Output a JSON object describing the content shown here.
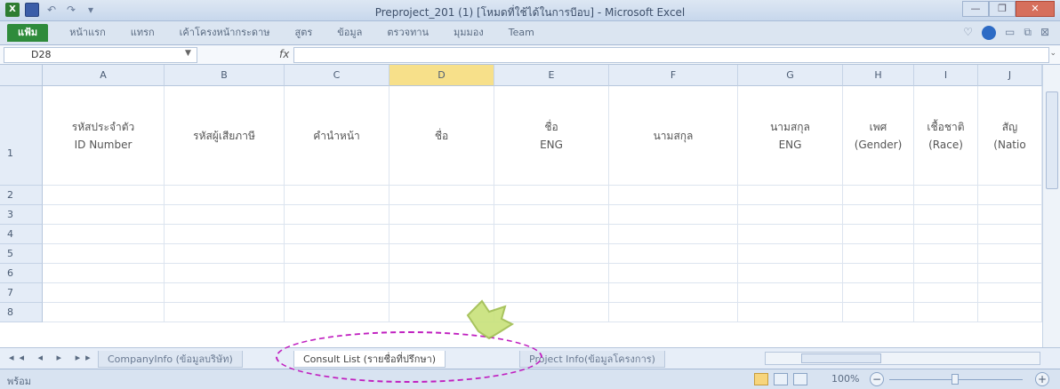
{
  "window": {
    "title": "Preproject_201 (1) [โหมดที่ใช้ได้ในการบีอบ] - Microsoft Excel",
    "qat_icons": [
      "excel-app-icon",
      "save-icon",
      "undo-icon",
      "redo-icon",
      "customize-qat-icon"
    ]
  },
  "ribbon": {
    "tabs": [
      "แฟ้ม",
      "หน้าแรก",
      "แทรก",
      "เค้าโครงหน้ากระดาษ",
      "สูตร",
      "ข้อมูล",
      "ตรวจทาน",
      "มุมมอง",
      "Team"
    ]
  },
  "formula_bar": {
    "cell_ref": "D28",
    "fx_label": "fx",
    "content": ""
  },
  "grid": {
    "columns": [
      "A",
      "B",
      "C",
      "D",
      "E",
      "F",
      "G",
      "H",
      "I",
      "J"
    ],
    "selected_column": "D",
    "rows": [
      "1",
      "2",
      "3",
      "4",
      "5",
      "6",
      "7",
      "8"
    ],
    "header_row": [
      {
        "line1": "รหัสประจำตัว",
        "line2": "ID Number"
      },
      {
        "line1": "รหัสผู้เสียภาษี",
        "line2": ""
      },
      {
        "line1": "คำนำหน้า",
        "line2": ""
      },
      {
        "line1": "ชื่อ",
        "line2": ""
      },
      {
        "line1": "ชื่อ",
        "line2": "ENG"
      },
      {
        "line1": "นามสกุล",
        "line2": ""
      },
      {
        "line1": "นามสกุล",
        "line2": "ENG"
      },
      {
        "line1": "เพศ",
        "line2": "(Gender)"
      },
      {
        "line1": "เชื้อชาติ",
        "line2": "(Race)"
      },
      {
        "line1": "สัญ",
        "line2": "(Natio"
      }
    ]
  },
  "sheets": {
    "nav": "◂◂ ◂ ▸ ▸▸",
    "tabs": [
      {
        "label": "CompanyInfo (ข้อมูลบริษัท)",
        "active": false
      },
      {
        "label": "Consult List (รายชื่อที่ปรึกษา)",
        "active": true
      },
      {
        "label": "Project Info(ข้อมูลโครงการ)",
        "active": false
      }
    ]
  },
  "status": {
    "mode": "พร้อม",
    "zoom": "100%"
  },
  "colors": {
    "file_tab": "#2f8b3b",
    "selected_col": "#f7e08a",
    "annotation": "#c020c0",
    "cursor": "#c8e27a"
  }
}
